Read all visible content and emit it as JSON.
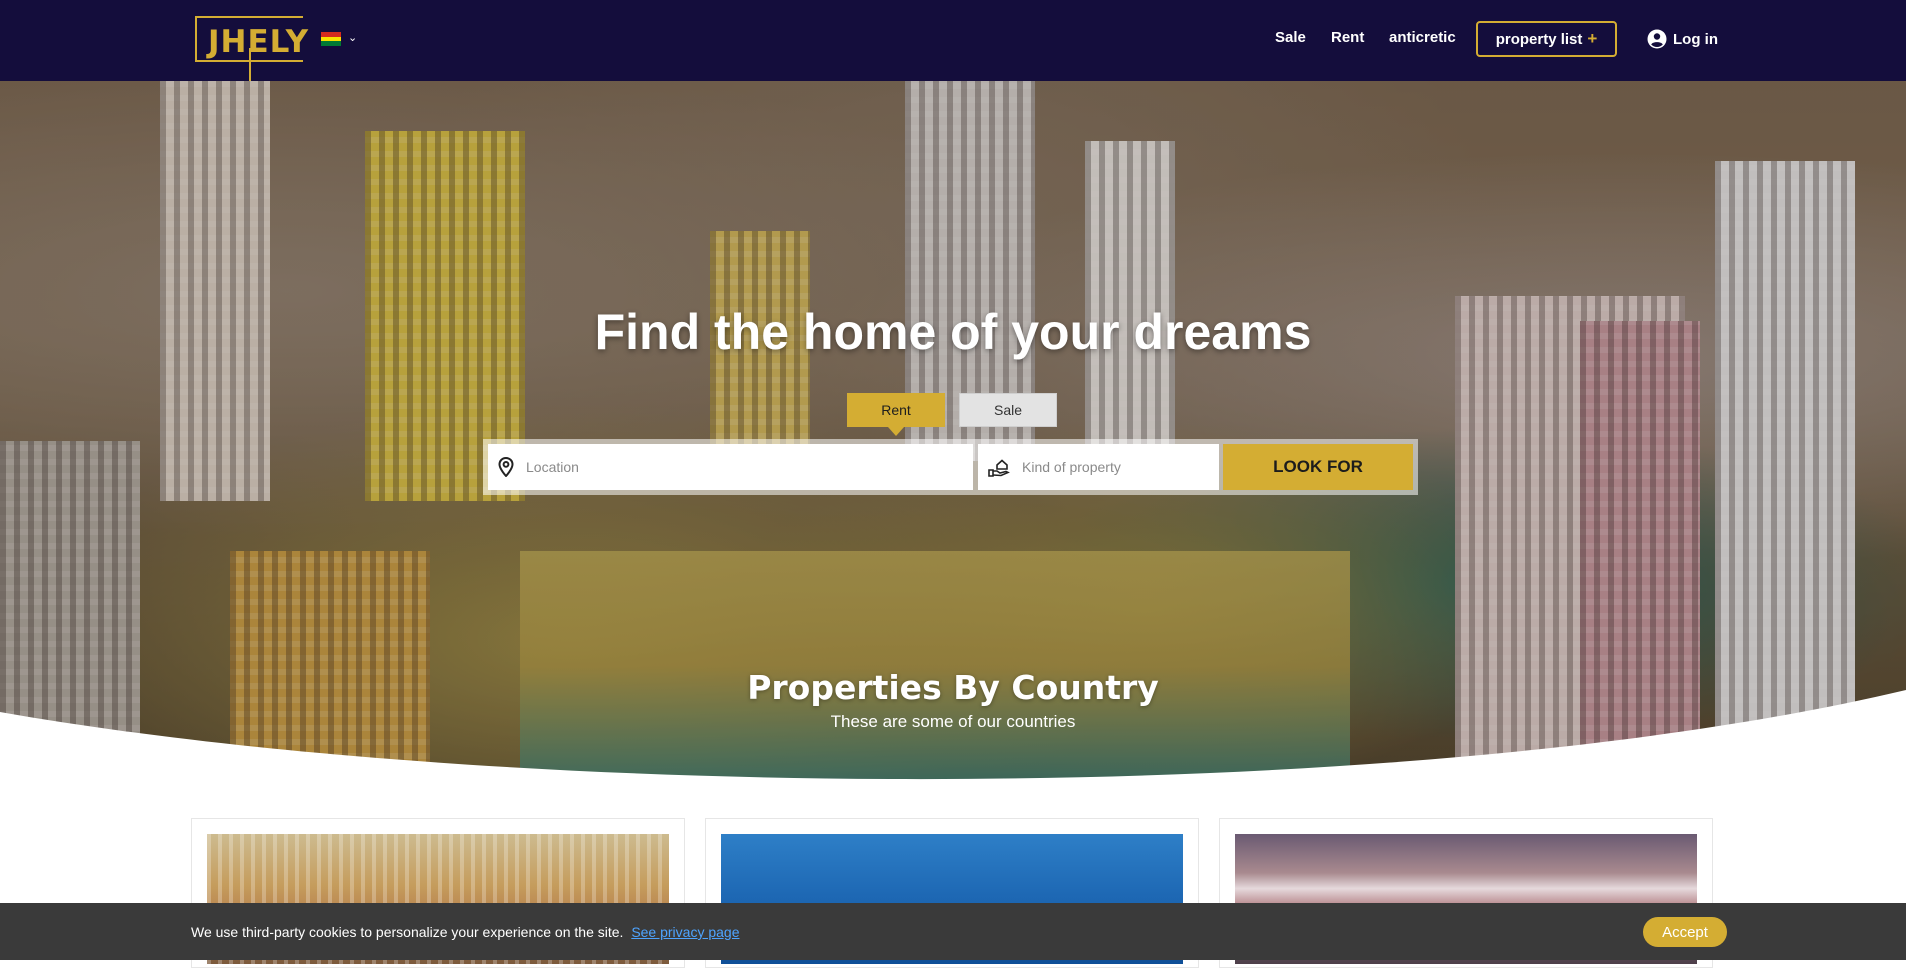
{
  "brand": {
    "logo_text": "JHELY"
  },
  "header": {
    "language_icon": "bolivia-flag-icon",
    "nav": {
      "sale": "Sale",
      "rent": "Rent",
      "anticretic": "anticretic"
    },
    "property_list_label": "property list",
    "property_list_plus": "+",
    "login_label": "Log in"
  },
  "hero": {
    "title": "Find the home of your dreams",
    "tabs": {
      "rent": "Rent",
      "sale": "Sale"
    },
    "search": {
      "location_placeholder": "Location",
      "kind_placeholder": "Kind of property",
      "button_label": "LOOK FOR"
    }
  },
  "countries_section": {
    "title": "Properties By Country",
    "subtitle": "These are some of our countries"
  },
  "cookie_bar": {
    "text": "We use third-party cookies to personalize your experience on the site.",
    "link_text": "See privacy page",
    "accept_label": "Accept"
  },
  "colors": {
    "navbar": "#140d3c",
    "accent": "#d4ad33",
    "cookie_bg": "#3a3a3a"
  }
}
